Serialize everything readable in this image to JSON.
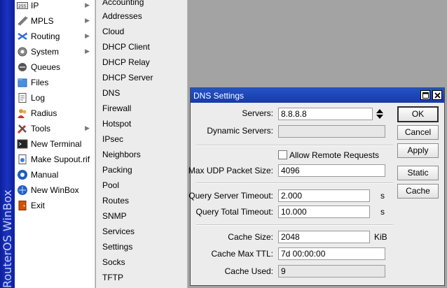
{
  "brand": {
    "text": "RouterOS WinBox"
  },
  "main_menu": [
    {
      "label": "IP",
      "icon": "ip-icon",
      "arrow": true
    },
    {
      "label": "MPLS",
      "icon": "mpls-icon",
      "arrow": true
    },
    {
      "label": "Routing",
      "icon": "routing-icon",
      "arrow": true
    },
    {
      "label": "System",
      "icon": "system-gear-icon",
      "arrow": true
    },
    {
      "label": "Queues",
      "icon": "queues-icon",
      "arrow": false
    },
    {
      "label": "Files",
      "icon": "files-icon",
      "arrow": false
    },
    {
      "label": "Log",
      "icon": "log-icon",
      "arrow": false
    },
    {
      "label": "Radius",
      "icon": "radius-icon",
      "arrow": false
    },
    {
      "label": "Tools",
      "icon": "tools-icon",
      "arrow": true
    },
    {
      "label": "New Terminal",
      "icon": "terminal-icon",
      "arrow": false
    },
    {
      "label": "Make Supout.rif",
      "icon": "supout-icon",
      "arrow": false
    },
    {
      "label": "Manual",
      "icon": "manual-icon",
      "arrow": false
    },
    {
      "label": "New WinBox",
      "icon": "winbox-icon",
      "arrow": false
    },
    {
      "label": "Exit",
      "icon": "exit-icon",
      "arrow": false
    }
  ],
  "ip_submenu": [
    "Accounting",
    "Addresses",
    "Cloud",
    "DHCP Client",
    "DHCP Relay",
    "DHCP Server",
    "DNS",
    "Firewall",
    "Hotspot",
    "IPsec",
    "Neighbors",
    "Packing",
    "Pool",
    "Routes",
    "SNMP",
    "Services",
    "Settings",
    "Socks",
    "TFTP"
  ],
  "dialog": {
    "title": "DNS Settings",
    "servers_label": "Servers:",
    "servers_value": "8.8.8.8",
    "dynamic_servers_label": "Dynamic Servers:",
    "dynamic_servers_value": "",
    "allow_remote_label": "Allow Remote Requests",
    "allow_remote_checked": false,
    "max_udp_label": "Max UDP Packet Size:",
    "max_udp_value": "4096",
    "query_server_timeout_label": "Query Server Timeout:",
    "query_server_timeout_value": "2.000",
    "query_total_timeout_label": "Query Total Timeout:",
    "query_total_timeout_value": "10.000",
    "seconds_unit": "s",
    "cache_size_label": "Cache Size:",
    "cache_size_value": "2048",
    "cache_size_unit": "KiB",
    "cache_max_ttl_label": "Cache Max TTL:",
    "cache_max_ttl_value": "7d 00:00:00",
    "cache_used_label": "Cache Used:",
    "cache_used_value": "9",
    "buttons": {
      "ok": "OK",
      "cancel": "Cancel",
      "apply": "Apply",
      "static": "Static",
      "cache": "Cache"
    }
  },
  "colors": {
    "titlebar": "#1f48bd",
    "brand_strip": "#1a33c0",
    "menu_bg": "#ffffff",
    "submenu_bg": "#ececec"
  }
}
